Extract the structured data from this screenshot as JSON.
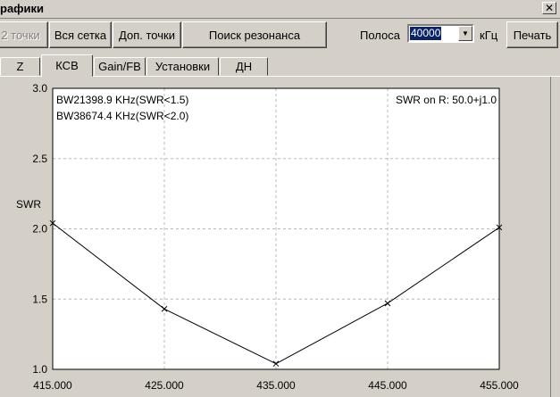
{
  "window": {
    "title": "рафики",
    "close_label": "✕"
  },
  "toolbar": {
    "points_label": "2 точки",
    "full_grid_label": "Вся сетка",
    "extra_points_label": "Доп. точки",
    "resonance_label": "Поиск резонанса",
    "band_label": "Полоса",
    "band_value": "40000",
    "band_unit": "кГц",
    "print_label": "Печать"
  },
  "tabs": [
    {
      "label": "Z"
    },
    {
      "label": "КСВ",
      "active": true
    },
    {
      "label": "Gain/FB"
    },
    {
      "label": "Установки"
    },
    {
      "label": "ДН"
    }
  ],
  "chart_data": {
    "type": "line",
    "ylabel": "SWR",
    "xlim": [
      415,
      455
    ],
    "ylim": [
      1.0,
      3.0
    ],
    "grid": true,
    "x_ticks": [
      "415.000",
      "425.000",
      "435.000",
      "445.000",
      "455.000"
    ],
    "y_ticks": [
      "1.0",
      "1.5",
      "2.0",
      "2.5",
      "3.0"
    ],
    "annotations": [
      "BW21398.9 KHz(SWR<1.5)",
      "BW38674.4 KHz(SWR<2.0)",
      "SWR on R: 50.0+j1.0"
    ],
    "series": [
      {
        "x": [
          415,
          425,
          435,
          445,
          455
        ],
        "values": [
          2.04,
          1.43,
          1.04,
          1.47,
          2.01
        ]
      }
    ]
  }
}
